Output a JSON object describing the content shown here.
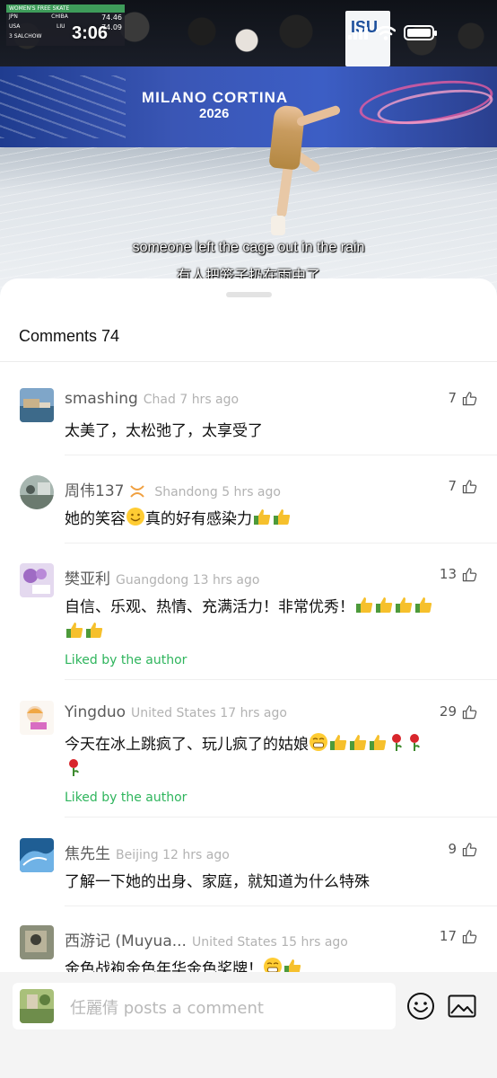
{
  "status_bar": {
    "time": "3:06"
  },
  "video": {
    "scoreboard": {
      "header": "WOMEN'S FREE SKATE",
      "rows": [
        {
          "country": "JPN",
          "name": "CHIBA",
          "score": "74.46"
        },
        {
          "country": "USA",
          "name": "LIU",
          "score": "74.09"
        }
      ],
      "element": "3 SALCHOW"
    },
    "board_logo": "ISU",
    "brand": "MILANO CORTINA",
    "brand_year": "2026",
    "subtitle_en": "someone left the cage out in the rain",
    "subtitle_zh": "有人把笼子扔在雨中了"
  },
  "comments_sheet": {
    "title": "Comments 74",
    "comments": [
      {
        "name": "smashing",
        "meta": "Chad 7 hrs ago",
        "likes": "7",
        "text": "太美了，太松弛了，太享受了",
        "liked_by_author": ""
      },
      {
        "name": "周伟137",
        "meta": "Shandong 5 hrs ago",
        "likes": "7",
        "text": "她的笑容",
        "text2": "真的好有感染力",
        "liked_by_author": ""
      },
      {
        "name": "樊亚利",
        "meta": "Guangdong 13 hrs ago",
        "likes": "13",
        "text": "自信、乐观、热情、充满活力！非常优秀！",
        "liked_by_author": "Liked by the author"
      },
      {
        "name": "Yingduo",
        "meta": "United States 17 hrs ago",
        "likes": "29",
        "text": "今天在冰上跳疯了、玩儿疯了的姑娘",
        "liked_by_author": "Liked by the author"
      },
      {
        "name": "焦先生",
        "meta": "Beijing 12 hrs ago",
        "likes": "9",
        "text": "了解一下她的出身、家庭，就知道为什么特殊",
        "liked_by_author": ""
      },
      {
        "name": "西游记 (Muyua...",
        "meta": "United States 15 hrs ago",
        "likes": "17",
        "text": "金色战袍金色年华金色奖牌！",
        "liked_by_author": ""
      }
    ]
  },
  "composer": {
    "placeholder": "任麗倩 posts a comment"
  },
  "icons": {
    "like": "thumbs-up-outline-icon",
    "emoji": "smiley-face-icon",
    "image": "image-icon"
  },
  "colors": {
    "liked_green": "#2fb55d",
    "meta_gray": "#b2b2b2",
    "name_gray": "#5b5b5b"
  }
}
